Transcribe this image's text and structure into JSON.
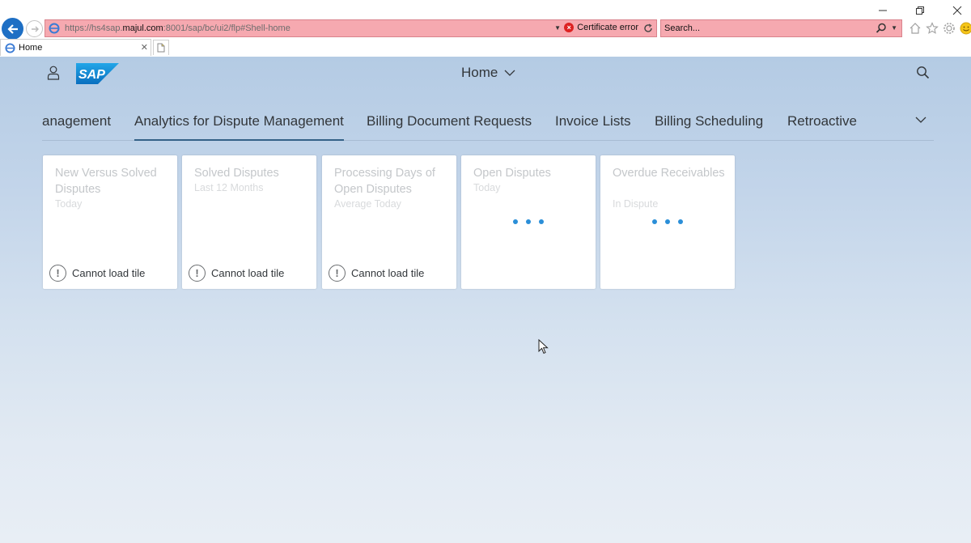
{
  "browser": {
    "window_controls": [
      "minimize",
      "restore",
      "close"
    ],
    "address": {
      "url_prefix": "https://hs4sap.",
      "url_host": "majul.com",
      "url_suffix": ":8001/sap/bc/ui2/flp#Shell-home",
      "certificate_label": "Certificate error"
    },
    "search": {
      "placeholder": "Search..."
    },
    "tab": {
      "label": "Home"
    },
    "colors": {
      "error_bar": "#f6a9b0",
      "back_button": "#1e6fc4"
    }
  },
  "shell": {
    "title": "Home",
    "logo_text": "SAP"
  },
  "anchor_bar": {
    "items": [
      {
        "label": "anagement",
        "active": false
      },
      {
        "label": "Analytics for Dispute Management",
        "active": true
      },
      {
        "label": "Billing Document Requests",
        "active": false
      },
      {
        "label": "Invoice Lists",
        "active": false
      },
      {
        "label": "Billing Scheduling",
        "active": false
      },
      {
        "label": "Retroactive",
        "active": false
      }
    ]
  },
  "tiles": [
    {
      "title": "New Versus Solved Disputes",
      "subtitle": "Today",
      "status": "Cannot load tile"
    },
    {
      "title": "Solved Disputes",
      "subtitle": "Last 12 Months",
      "status": "Cannot load tile"
    },
    {
      "title": "Processing Days of Open Disputes",
      "subtitle": "Average Today",
      "status": "Cannot load tile"
    },
    {
      "title": "Open Disputes",
      "subtitle": "Today",
      "status": "loading"
    },
    {
      "title": "Overdue Receivables",
      "subtitle": "In Dispute",
      "status": "loading"
    }
  ],
  "colors": {
    "accent": "#346187",
    "busy_indicator": "#2b8fd8",
    "text": "#32363a"
  }
}
